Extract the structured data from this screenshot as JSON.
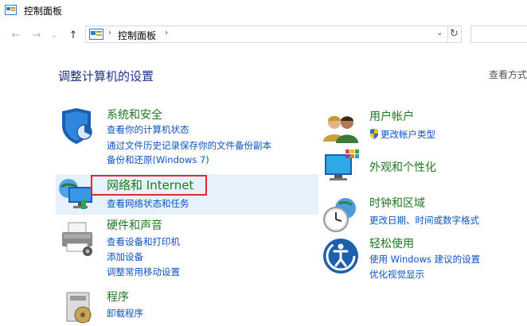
{
  "window": {
    "title": "控制面板"
  },
  "nav": {
    "back_glyph": "←",
    "forward_glyph": "→",
    "recent_glyph": "⌄",
    "up_glyph": "↑",
    "address": "控制面板",
    "sep_glyph": "›",
    "dropdown_glyph": "⌄",
    "refresh_glyph": "↻"
  },
  "page": {
    "heading": "调整计算机的设置",
    "view_by": "查看方式"
  },
  "categories": {
    "system": {
      "title": "系统和安全",
      "icon": "shield-icon",
      "links": [
        "查看你的计算机状态",
        "通过文件历史记录保存你的文件备份副本",
        "备份和还原(Windows 7)"
      ]
    },
    "network": {
      "title": "网络和 Internet",
      "icon": "network-icon",
      "links": [
        "查看网络状态和任务"
      ]
    },
    "hardware": {
      "title": "硬件和声音",
      "icon": "printer-icon",
      "links": [
        "查看设备和打印机",
        "添加设备",
        "调整常用移动设置"
      ]
    },
    "programs": {
      "title": "程序",
      "icon": "programs-icon",
      "links": [
        "卸载程序"
      ]
    },
    "users": {
      "title": "用户帐户",
      "icon": "users-icon",
      "links": [
        "更改帐户类型"
      ]
    },
    "appearance": {
      "title": "外观和个性化",
      "icon": "appearance-icon",
      "links": []
    },
    "clock": {
      "title": "时钟和区域",
      "icon": "clock-icon",
      "links": [
        "更改日期、时间或数字格式"
      ]
    },
    "ease": {
      "title": "轻松使用",
      "icon": "ease-of-access-icon",
      "links": [
        "使用 Windows 建议的设置",
        "优化视觉显示"
      ]
    }
  },
  "colors": {
    "category_title": "#1f7a1f",
    "link": "#0b55c4",
    "heading": "#1e3287",
    "highlight": "#e6f1fb",
    "annotation_box": "#e8272a"
  }
}
